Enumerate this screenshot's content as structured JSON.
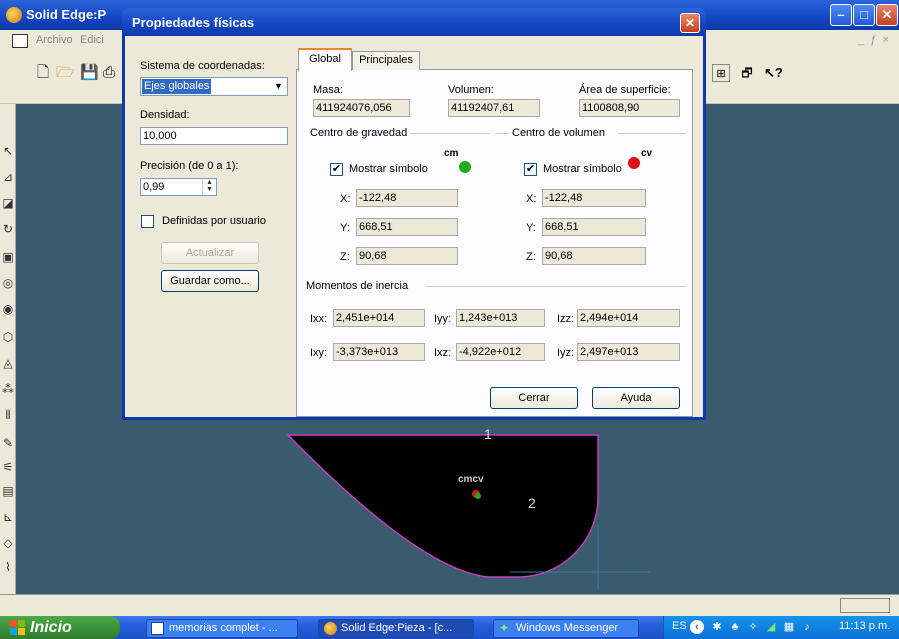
{
  "app": {
    "title": "Solid Edge:P",
    "menu": [
      "Archivo",
      "Edici"
    ]
  },
  "dialog": {
    "title": "Propiedades físicas",
    "close_glyph": "✕",
    "left": {
      "coord_label": "Sistema de coordenadas:",
      "coord_value": "Ejes globales",
      "density_label": "Densidad:",
      "density_value": "10,000",
      "precision_label": "Precisión (de 0 a 1):",
      "precision_value": "0,99",
      "user_defined_label": "Definidas por usuario",
      "user_defined_checked": false,
      "update_button": "Actualizar",
      "save_as_button": "Guardar como..."
    },
    "tabs": [
      "Global",
      "Principales"
    ],
    "active_tab": "Global",
    "global": {
      "mass_label": "Masa:",
      "mass_value": "411924076,056",
      "volume_label": "Volumen:",
      "volume_value": "41192407,61",
      "area_label": "Área de superficie:",
      "area_value": "1100808,90",
      "cog": {
        "title": "Centro de gravedad",
        "show_symbol_label": "Mostrar símbolo",
        "show_symbol_checked": true,
        "symbol_text": "cm",
        "symbol_color": "#22aa22",
        "x_label": "X:",
        "x_value": "-122,48",
        "y_label": "Y:",
        "y_value": "668,51",
        "z_label": "Z:",
        "z_value": "90,68"
      },
      "cov": {
        "title": "Centro de volumen",
        "show_symbol_label": "Mostrar símbolo",
        "show_symbol_checked": true,
        "symbol_text": "cv",
        "symbol_color": "#dd1111",
        "x_label": "X:",
        "x_value": "-122,48",
        "y_label": "Y:",
        "y_value": "668,51",
        "z_label": "Z:",
        "z_value": "90,68"
      },
      "inertia": {
        "title": "Momentos de inercia",
        "ixx_label": "Ixx:",
        "ixx_value": "2,451e+014",
        "iyy_label": "Iyy:",
        "iyy_value": "1,243e+013",
        "izz_label": "Izz:",
        "izz_value": "2,494e+014",
        "ixy_label": "Ixy:",
        "ixy_value": "-3,373e+013",
        "ixz_label": "Ixz:",
        "ixz_value": "-4,922e+012",
        "iyz_label": "Iyz:",
        "iyz_value": "2,497e+013"
      }
    },
    "close_button": "Cerrar",
    "help_button": "Ayuda"
  },
  "canvas": {
    "label_1": "1",
    "label_2": "2",
    "center_label": "cmcv",
    "shape_fill": "#000000",
    "shape_edge": "#c040c0"
  },
  "taskbar": {
    "start": "Inicio",
    "items": [
      {
        "label": "memorias complet - ..."
      },
      {
        "label": "Solid Edge:Pieza - [c..."
      },
      {
        "label": "Windows Messenger"
      }
    ],
    "lang": "ES",
    "clock": "11:13 p.m."
  }
}
